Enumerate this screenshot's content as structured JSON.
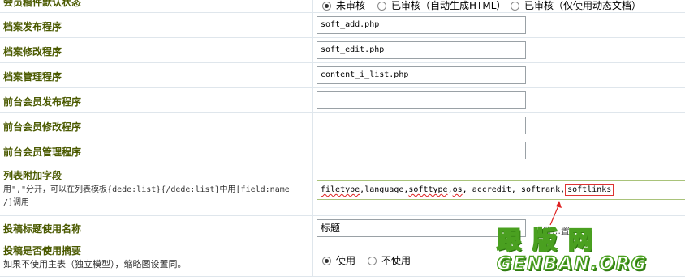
{
  "rows": [
    {
      "label": "会员稿件默认状态",
      "options": [
        {
          "label": "未审核",
          "checked": true
        },
        {
          "label": "已审核（自动生成HTML）",
          "checked": false
        },
        {
          "label": "已审核（仅使用动态文档）",
          "checked": false
        }
      ]
    },
    {
      "label": "档案发布程序",
      "value": "soft_add.php"
    },
    {
      "label": "档案修改程序",
      "value": "soft_edit.php"
    },
    {
      "label": "档案管理程序",
      "value": "content_i_list.php"
    },
    {
      "label": "前台会员发布程序",
      "value": ""
    },
    {
      "label": "前台会员修改程序",
      "value": ""
    },
    {
      "label": "前台会员管理程序",
      "value": ""
    }
  ],
  "list_fields": {
    "label": "列表附加字段",
    "hint_line1": "用\",\"分开，可以在列表模板{dede:list}{/dede:list}中用[field:name",
    "hint_line2": "/]调用",
    "items": [
      "filetype",
      "language",
      "softtype",
      "os",
      "accredit",
      "softrank",
      "softlinks"
    ]
  },
  "title_name": {
    "label": "投稿标题使用名称",
    "value": "标题"
  },
  "summary": {
    "label": "投稿是否使用摘要",
    "sub": "如果不使用主表（独立模型），缩略图设置同。",
    "options": [
      {
        "label": "使用",
        "checked": true
      },
      {
        "label": "不使用",
        "checked": false
      }
    ]
  },
  "watermark": {
    "text_cn": "跟版网",
    "text_en": "GENBAN.ORG",
    "partial_text": "收…置"
  },
  "colors": {
    "label_text": "#4b5a00",
    "watermark_green": "#4aa020",
    "annotation_red": "#d22"
  }
}
